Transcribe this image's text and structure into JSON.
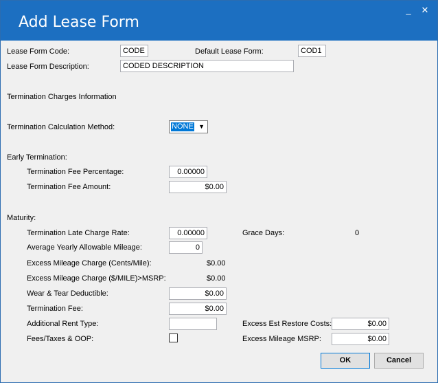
{
  "window": {
    "title": "Add Lease Form",
    "minimize_glyph": "_",
    "close_glyph": "✕"
  },
  "header": {
    "code_label": "Lease Form Code:",
    "code_value": "CODE",
    "default_label": "Default Lease Form:",
    "default_value": "COD1",
    "description_label": "Lease Form Description:",
    "description_value": "CODED DESCRIPTION"
  },
  "termination": {
    "section_label": "Termination Charges Information",
    "method_label": "Termination Calculation Method:",
    "method_value": "NONE"
  },
  "early": {
    "section_label": "Early Termination:",
    "fee_pct_label": "Termination Fee Percentage:",
    "fee_pct_value": "0.00000",
    "fee_amt_label": "Termination Fee Amount:",
    "fee_amt_value": "$0.00"
  },
  "maturity": {
    "section_label": "Maturity:",
    "late_rate_label": "Termination Late Charge Rate:",
    "late_rate_value": "0.00000",
    "grace_label": "Grace Days:",
    "grace_value": "0",
    "mileage_label": "Average Yearly Allowable Mileage:",
    "mileage_value": "0",
    "excess_cents_label": "Excess Mileage Charge (Cents/Mile):",
    "excess_cents_value": "$0.00",
    "excess_msrp_label": "Excess Mileage Charge ($/MILE)>MSRP:",
    "excess_msrp_value": "$0.00",
    "wear_label": "Wear & Tear Deductible:",
    "wear_value": "$0.00",
    "term_fee_label": "Termination Fee:",
    "term_fee_value": "$0.00",
    "rent_type_label": "Additional Rent Type:",
    "rent_type_value": "",
    "restore_label": "Excess Est Restore Costs:",
    "restore_value": "$0.00",
    "fees_label": "Fees/Taxes & OOP:",
    "fees_checked": false,
    "excess_mileage_msrp_label": "Excess Mileage MSRP:",
    "excess_mileage_msrp_value": "$0.00"
  },
  "buttons": {
    "ok": "OK",
    "cancel": "Cancel"
  }
}
